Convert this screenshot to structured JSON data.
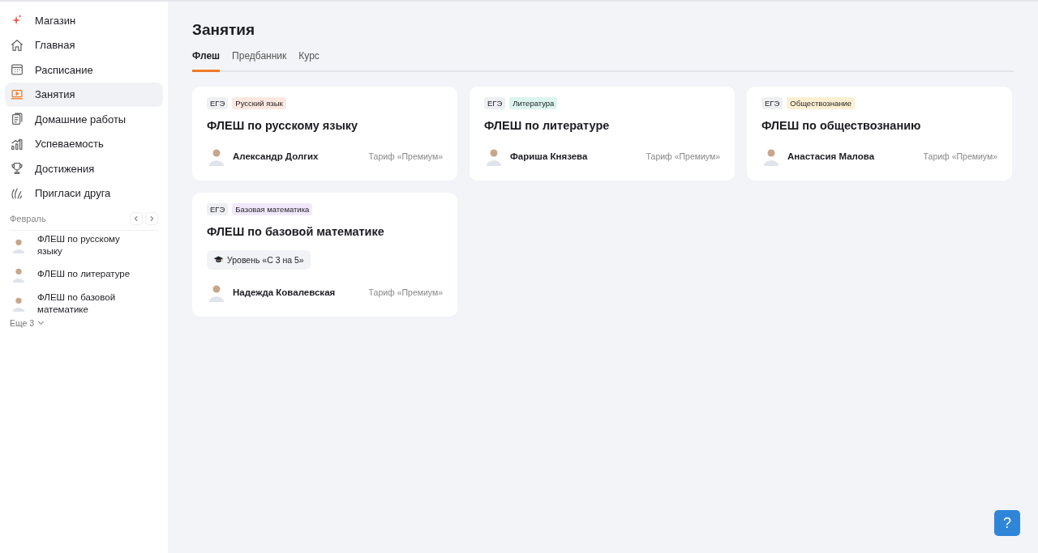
{
  "sidebar": {
    "items": [
      {
        "label": "Магазин",
        "kind": "shop",
        "selected": false
      },
      {
        "label": "Главная",
        "kind": "home",
        "selected": false
      },
      {
        "label": "Расписание",
        "kind": "calendar",
        "selected": false
      },
      {
        "label": "Занятия",
        "kind": "lessons",
        "selected": true
      },
      {
        "label": "Домашние работы",
        "kind": "homework",
        "selected": false
      },
      {
        "label": "Успеваемость",
        "kind": "progress",
        "selected": false
      },
      {
        "label": "Достижения",
        "kind": "trophy",
        "selected": false
      },
      {
        "label": "Пригласи друга",
        "kind": "invite",
        "selected": false
      }
    ],
    "month": "Февраль",
    "lessons": [
      {
        "title": "ФЛЕШ по русскому языку"
      },
      {
        "title": "ФЛЕШ по литературе"
      },
      {
        "title": "ФЛЕШ по базовой математике"
      }
    ],
    "more": "Еще 3"
  },
  "page": {
    "title": "Занятия",
    "tabs": [
      {
        "label": "Флеш",
        "selected": true
      },
      {
        "label": "Предбанник",
        "selected": false
      },
      {
        "label": "Курс",
        "selected": false
      }
    ],
    "cards": [
      {
        "exam": "ЕГЭ",
        "subject": "Русский язык",
        "color": "#fde8e1",
        "title": "ФЛЕШ по русскому языку",
        "teacher": "Александр Долгих",
        "plan": "Тариф «Премиум»"
      },
      {
        "exam": "ЕГЭ",
        "subject": "Литература",
        "color": "#ddf5ee",
        "title": "ФЛЕШ по литературе",
        "teacher": "Фариша Князева",
        "plan": "Тариф «Премиум»"
      },
      {
        "exam": "ЕГЭ",
        "subject": "Обществознание",
        "color": "#fdf0d2",
        "title": "ФЛЕШ по обществознанию",
        "teacher": "Анастасия Малова",
        "plan": "Тариф «Премиум»"
      },
      {
        "exam": "ЕГЭ",
        "subject": "Базовая математика",
        "color": "#f1e9fb",
        "title": "ФЛЕШ по базовой математике",
        "level": "Уровень «С 3 на 5»",
        "teacher": "Надежда Ковалевская",
        "plan": "Тариф «Премиум»"
      }
    ]
  },
  "help": "?"
}
